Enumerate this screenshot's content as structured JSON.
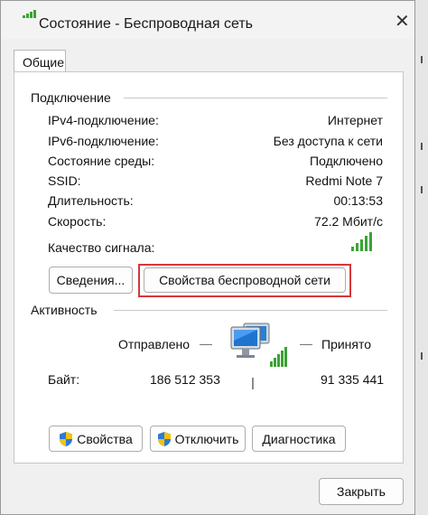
{
  "window": {
    "title": "Состояние - Беспроводная сеть",
    "close_glyph": "✕"
  },
  "tabs": [
    {
      "label": "Общие",
      "selected": true
    }
  ],
  "connection": {
    "heading": "Подключение",
    "rows": [
      {
        "label": "IPv4-подключение:",
        "value": "Интернет"
      },
      {
        "label": "IPv6-подключение:",
        "value": "Без доступа к сети"
      },
      {
        "label": "Состояние среды:",
        "value": "Подключено"
      },
      {
        "label": "SSID:",
        "value": "Redmi Note 7"
      },
      {
        "label": "Длительность:",
        "value": "00:13:53"
      },
      {
        "label": "Скорость:",
        "value": "72.2 Мбит/с"
      }
    ],
    "signal_label": "Качество сигнала:",
    "signal_bars": 5,
    "details_button": "Сведения...",
    "wireless_props_button": "Свойства беспроводной сети"
  },
  "activity": {
    "heading": "Активность",
    "sent_label": "Отправлено",
    "received_label": "Принято",
    "bytes_label": "Байт:",
    "sent_bytes": "186 512 353",
    "received_bytes": "91 335 441"
  },
  "actions": {
    "properties_button": "Свойства",
    "disable_button": "Отключить",
    "diagnose_button": "Диагностика"
  },
  "footer": {
    "close_button": "Закрыть"
  },
  "colors": {
    "signal": "#3aa335",
    "highlight": "#d5383a",
    "monitor": "#2a7fd4"
  },
  "icons": [
    "wireless-signal-icon",
    "network-computers-icon",
    "shield-icon",
    "close-icon"
  ]
}
